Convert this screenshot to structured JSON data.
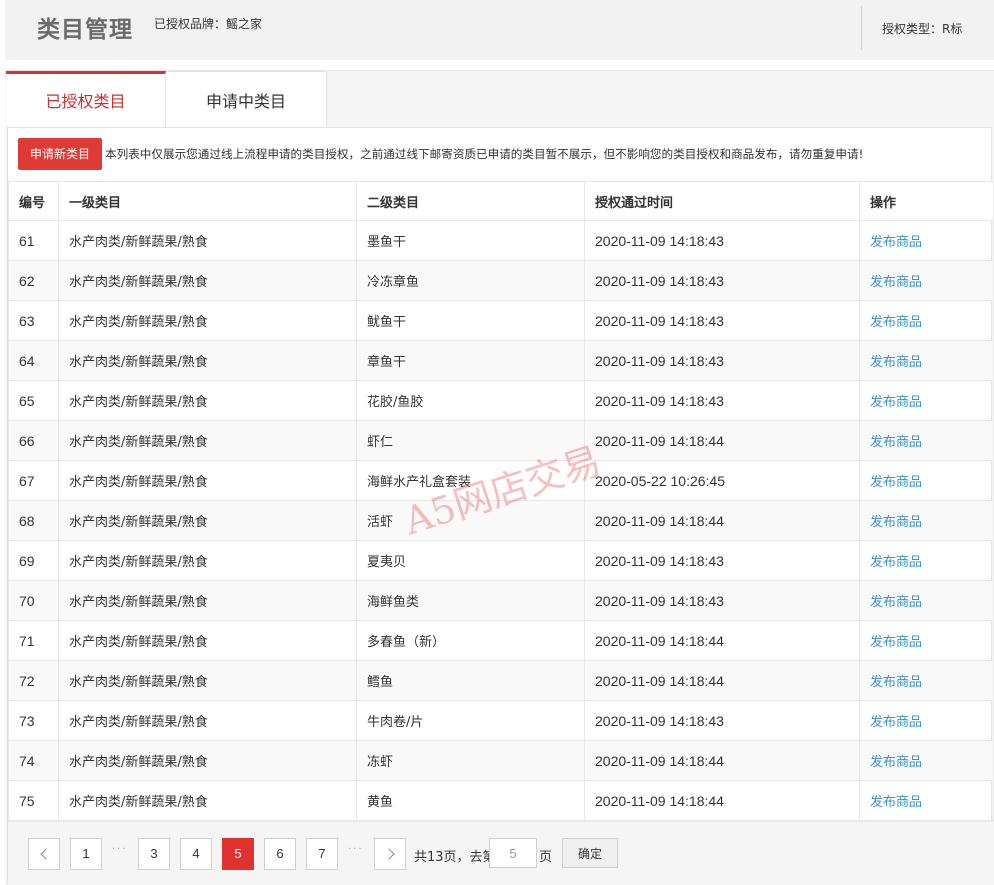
{
  "header": {
    "title": "类目管理",
    "brand_label": "已授权品牌：鳐之家",
    "auth_type_label": "授权类型：R标"
  },
  "tabs": [
    {
      "label": "已授权类目",
      "active": true
    },
    {
      "label": "申请中类目",
      "active": false
    }
  ],
  "notice": {
    "apply_button": "申请新类目",
    "text": "本列表中仅展示您通过线上流程申请的类目授权，之前通过线下邮寄资质已申请的类目暂不展示，但不影响您的类目授权和商品发布，请勿重复申请!"
  },
  "table": {
    "columns": [
      "编号",
      "一级类目",
      "二级类目",
      "授权通过时间",
      "操作"
    ],
    "rows": [
      {
        "id": "61",
        "cat1": "水产肉类/新鲜蔬果/熟食",
        "cat2": "墨鱼干",
        "time": "2020-11-09 14:18:43",
        "action": "发布商品"
      },
      {
        "id": "62",
        "cat1": "水产肉类/新鲜蔬果/熟食",
        "cat2": "冷冻章鱼",
        "time": "2020-11-09 14:18:43",
        "action": "发布商品"
      },
      {
        "id": "63",
        "cat1": "水产肉类/新鲜蔬果/熟食",
        "cat2": "鱿鱼干",
        "time": "2020-11-09 14:18:43",
        "action": "发布商品"
      },
      {
        "id": "64",
        "cat1": "水产肉类/新鲜蔬果/熟食",
        "cat2": "章鱼干",
        "time": "2020-11-09 14:18:43",
        "action": "发布商品"
      },
      {
        "id": "65",
        "cat1": "水产肉类/新鲜蔬果/熟食",
        "cat2": "花胶/鱼胶",
        "time": "2020-11-09 14:18:43",
        "action": "发布商品"
      },
      {
        "id": "66",
        "cat1": "水产肉类/新鲜蔬果/熟食",
        "cat2": "虾仁",
        "time": "2020-11-09 14:18:44",
        "action": "发布商品"
      },
      {
        "id": "67",
        "cat1": "水产肉类/新鲜蔬果/熟食",
        "cat2": "海鲜水产礼盒套装",
        "time": "2020-05-22 10:26:45",
        "action": "发布商品"
      },
      {
        "id": "68",
        "cat1": "水产肉类/新鲜蔬果/熟食",
        "cat2": "活虾",
        "time": "2020-11-09 14:18:44",
        "action": "发布商品"
      },
      {
        "id": "69",
        "cat1": "水产肉类/新鲜蔬果/熟食",
        "cat2": "夏夷贝",
        "time": "2020-11-09 14:18:43",
        "action": "发布商品"
      },
      {
        "id": "70",
        "cat1": "水产肉类/新鲜蔬果/熟食",
        "cat2": "海鲜鱼类",
        "time": "2020-11-09 14:18:43",
        "action": "发布商品"
      },
      {
        "id": "71",
        "cat1": "水产肉类/新鲜蔬果/熟食",
        "cat2": "多春鱼（新）",
        "time": "2020-11-09 14:18:44",
        "action": "发布商品"
      },
      {
        "id": "72",
        "cat1": "水产肉类/新鲜蔬果/熟食",
        "cat2": "鳕鱼",
        "time": "2020-11-09 14:18:44",
        "action": "发布商品"
      },
      {
        "id": "73",
        "cat1": "水产肉类/新鲜蔬果/熟食",
        "cat2": "牛肉卷/片",
        "time": "2020-11-09 14:18:43",
        "action": "发布商品"
      },
      {
        "id": "74",
        "cat1": "水产肉类/新鲜蔬果/熟食",
        "cat2": "冻虾",
        "time": "2020-11-09 14:18:44",
        "action": "发布商品"
      },
      {
        "id": "75",
        "cat1": "水产肉类/新鲜蔬果/熟食",
        "cat2": "黄鱼",
        "time": "2020-11-09 14:18:44",
        "action": "发布商品"
      }
    ]
  },
  "watermark": "A5网店交易",
  "pagination": {
    "pages": [
      "1",
      "3",
      "4",
      "5",
      "6",
      "7"
    ],
    "current": "5",
    "dots": "···",
    "total_label": "共13页，去第",
    "page_suffix": "页",
    "goto_value": "5",
    "confirm_label": "确定"
  },
  "colors": {
    "accent_red": "#df3b36",
    "link_blue": "#3a8fd1"
  }
}
